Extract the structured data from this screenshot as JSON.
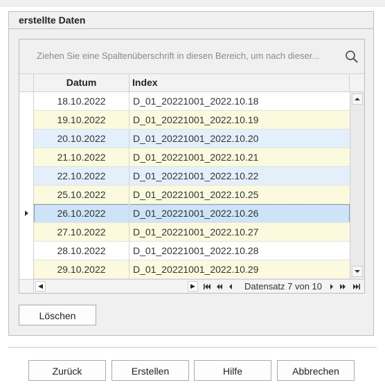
{
  "group": {
    "title": "erstellte Daten"
  },
  "search": {
    "placeholder": "Ziehen Sie eine Spaltenüberschrift in diesen Bereich, um nach dieser..."
  },
  "table": {
    "columns": [
      "Datum",
      "Index"
    ],
    "rows": [
      {
        "date": "18.10.2022",
        "index": "D_01_20221001_2022.10.18"
      },
      {
        "date": "19.10.2022",
        "index": "D_01_20221001_2022.10.19"
      },
      {
        "date": "20.10.2022",
        "index": "D_01_20221001_2022.10.20"
      },
      {
        "date": "21.10.2022",
        "index": "D_01_20221001_2022.10.21"
      },
      {
        "date": "22.10.2022",
        "index": "D_01_20221001_2022.10.22"
      },
      {
        "date": "25.10.2022",
        "index": "D_01_20221001_2022.10.25"
      },
      {
        "date": "26.10.2022",
        "index": "D_01_20221001_2022.10.26"
      },
      {
        "date": "27.10.2022",
        "index": "D_01_20221001_2022.10.27"
      },
      {
        "date": "28.10.2022",
        "index": "D_01_20221001_2022.10.28"
      },
      {
        "date": "29.10.2022",
        "index": "D_01_20221001_2022.10.29"
      }
    ],
    "selected_row": 7
  },
  "navigator": {
    "text": "Datensatz 7 von 10"
  },
  "buttons": {
    "delete": "Löschen",
    "back": "Zurück",
    "create": "Erstellen",
    "help": "Hilfe",
    "cancel": "Abbrechen"
  },
  "colors": {
    "row_white": "#ffffff",
    "row_yellow": "#fbfadf",
    "row_blue": "#e3f0fb",
    "row_selected": "#cde3f7"
  },
  "icons": {
    "search": "search-icon",
    "row_indicator": "row-indicator-icon",
    "scroll_up": "scroll-up-icon",
    "scroll_down": "scroll-down-icon",
    "first": "first-record-icon",
    "prev_page": "previous-page-icon",
    "prev": "previous-record-icon",
    "next": "next-record-icon",
    "next_page": "next-page-icon",
    "last": "last-record-icon"
  }
}
